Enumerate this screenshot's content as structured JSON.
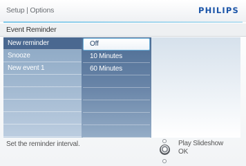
{
  "header": {
    "breadcrumb": "Setup | Options",
    "brand": "PHILIPS"
  },
  "section_title": "Event Reminder",
  "menu": {
    "items": [
      {
        "label": "New reminder",
        "selected": true
      },
      {
        "label": "Snooze",
        "selected": false
      },
      {
        "label": "New event 1",
        "selected": false
      },
      {
        "label": "",
        "selected": false
      },
      {
        "label": "",
        "selected": false
      },
      {
        "label": "",
        "selected": false
      },
      {
        "label": "",
        "selected": false
      },
      {
        "label": "",
        "selected": false
      }
    ]
  },
  "submenu": {
    "items": [
      {
        "label": "Off",
        "selected": true
      },
      {
        "label": "10 Minutes",
        "selected": false
      },
      {
        "label": "60 Minutes",
        "selected": false
      },
      {
        "label": "",
        "selected": false
      },
      {
        "label": "",
        "selected": false
      },
      {
        "label": "",
        "selected": false
      },
      {
        "label": "",
        "selected": false
      },
      {
        "label": "",
        "selected": false
      }
    ]
  },
  "footer": {
    "status_text": "Set the reminder interval.",
    "hint_play": "Play Slideshow",
    "hint_ok": "OK"
  },
  "colors": {
    "brand_blue": "#1a54a8",
    "accent_line": "#7ec7e8",
    "menu_selected": "#4a6890"
  },
  "icons": {
    "nav_up": "up-dot-icon",
    "nav_ok": "ok-joystick-icon",
    "nav_down": "down-dot-icon"
  }
}
